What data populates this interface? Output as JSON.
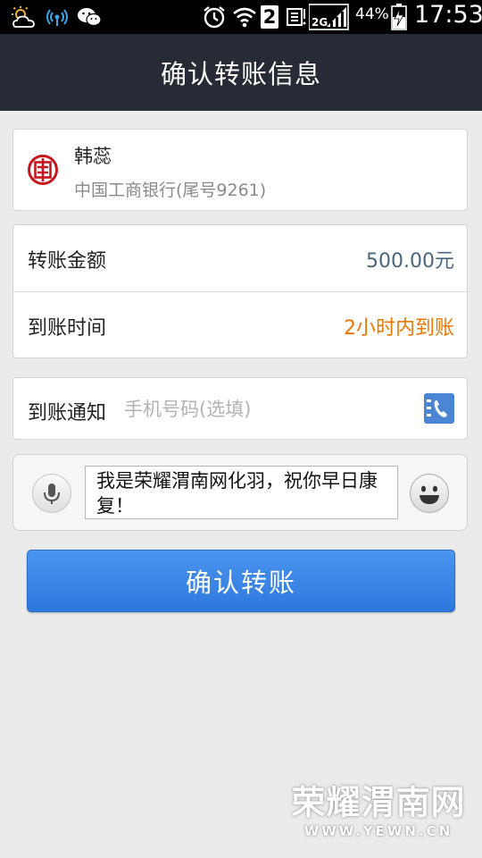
{
  "status_bar": {
    "battery_percent": "44%",
    "time": "17:53",
    "sim_number": "2",
    "network_type": "2G",
    "icons": [
      "weather-icon",
      "wifi-signal-icon",
      "wechat-icon",
      "alarm-icon",
      "wifi-icon",
      "sim-2-icon",
      "data-icon",
      "signal-2g-icon",
      "battery-icon"
    ]
  },
  "header": {
    "title": "确认转账信息"
  },
  "payee": {
    "name": "韩蕊",
    "bank": "中国工商银行(尾号9261)",
    "bank_icon": "icbc-logo-icon"
  },
  "transfer": {
    "amount_label": "转账金额",
    "amount_value": "500.00元",
    "arrival_label": "到账时间",
    "arrival_value": "2小时内到账"
  },
  "notify": {
    "label": "到账通知",
    "placeholder": "手机号码(选填)",
    "value": "",
    "contact_icon": "contact-book-icon"
  },
  "message": {
    "text": "我是荣耀渭南网化羽，祝你早日康复！",
    "mic_icon": "microphone-icon",
    "emoji_icon": "smiley-icon"
  },
  "confirm_button": {
    "label": "确认转账"
  },
  "watermark": {
    "title": "荣耀渭南网",
    "url": "WWW.YEWN.CN"
  },
  "colors": {
    "header_bg": "#262b35",
    "amount_text": "#4a6580",
    "arrival_text": "#ee7700",
    "button_bg": "#3a86e8",
    "icbc_red": "#c8161d"
  }
}
